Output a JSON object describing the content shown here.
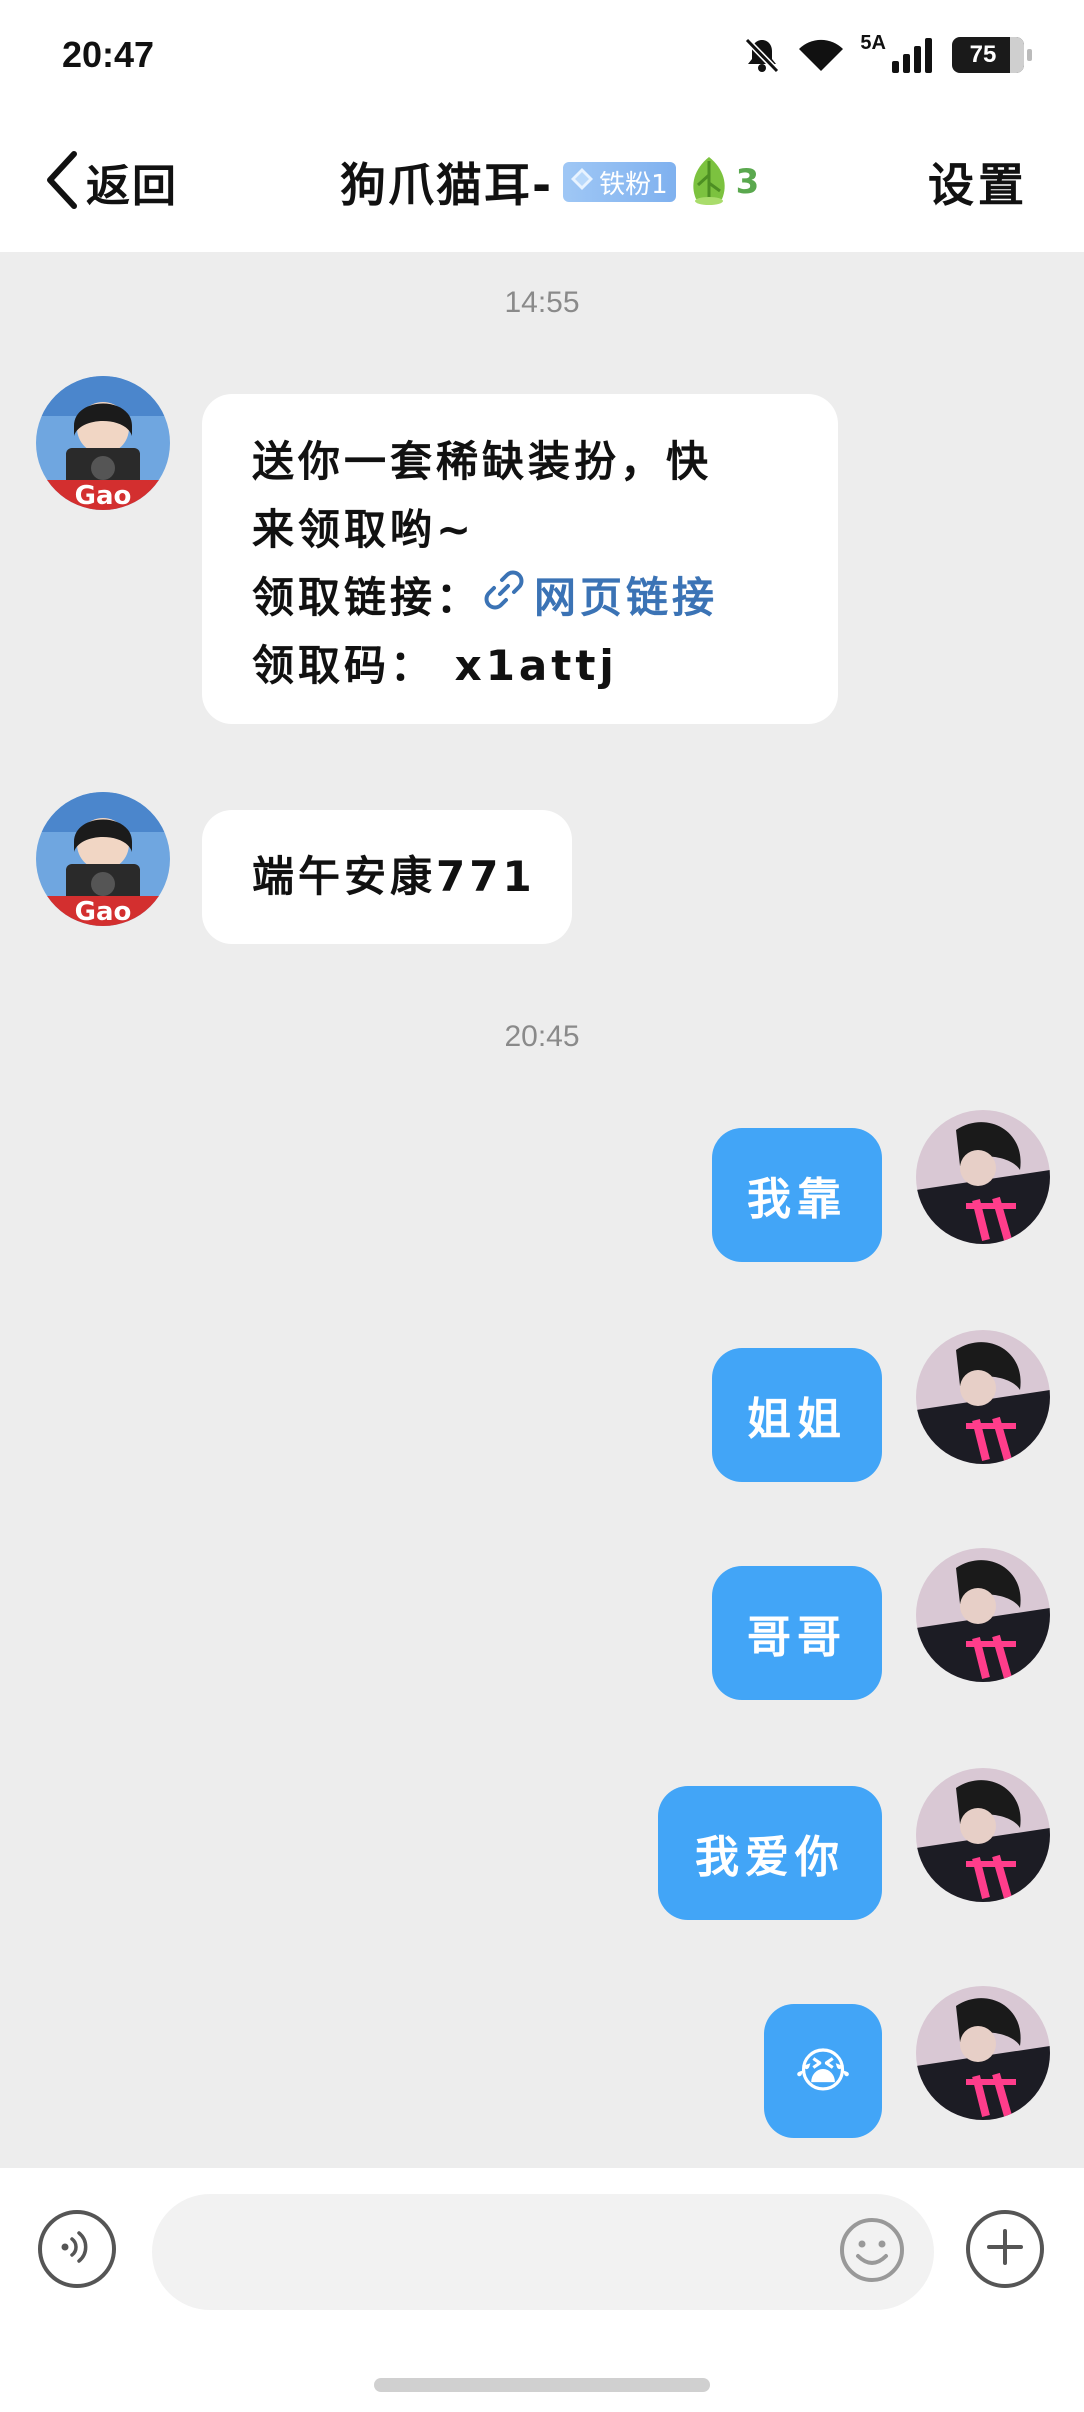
{
  "status_bar": {
    "time": "20:47",
    "network": "5A",
    "battery": "75",
    "icons": [
      "bell-muted-icon",
      "wifi-icon",
      "signal-icon",
      "battery-icon"
    ]
  },
  "header": {
    "back_label": "返回",
    "title": "狗爪猫耳-",
    "fan_badge": "铁粉1",
    "leaf_count": "3",
    "settings_label": "设置"
  },
  "chat": {
    "timestamp_1": "14:55",
    "msg1": {
      "line1": "送你一套稀缺装扮，快",
      "line2": "来领取哟~",
      "link_prefix": "领取链接：",
      "link_text": "网页链接",
      "code_line": "领取码：  x1attj"
    },
    "msg2": "端午安康771",
    "timestamp_2": "20:45",
    "outgoing": [
      "我靠",
      "姐姐",
      "哥哥",
      "我爱你"
    ],
    "outgoing_emoji": "😭"
  },
  "input_bar": {
    "placeholder": ""
  },
  "colors": {
    "outgoing_bubble": "#42a5f7",
    "link": "#3b73b5",
    "chat_background": "#ededed",
    "leaf_count": "#5aa84e"
  }
}
